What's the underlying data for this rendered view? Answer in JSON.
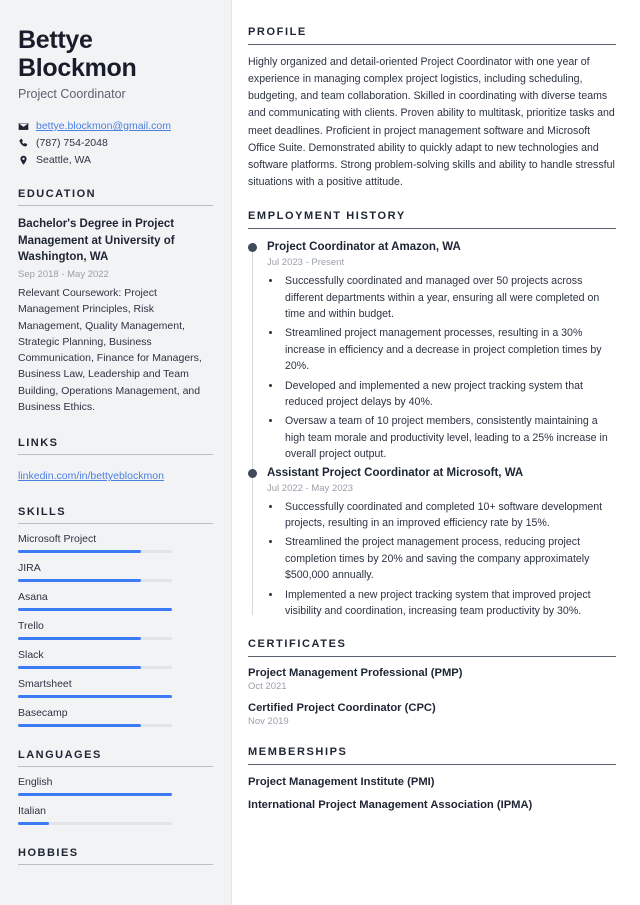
{
  "header": {
    "first_name": "Bettye",
    "last_name": "Blockmon",
    "job_title": "Project Coordinator",
    "contacts": [
      {
        "icon": "envelope-icon",
        "value": "bettye.blockmon@gmail.com",
        "is_link": true
      },
      {
        "icon": "phone-icon",
        "value": "(787) 754-2048",
        "is_link": false
      },
      {
        "icon": "location-pin-icon",
        "value": "Seattle, WA",
        "is_link": false
      }
    ]
  },
  "sidebar": {
    "education": {
      "heading": "EDUCATION",
      "degree": "Bachelor's Degree in Project Management at University of Washington, WA",
      "date": "Sep 2018 - May 2022",
      "description": "Relevant Coursework: Project Management Principles, Risk Management, Quality Management, Strategic Planning, Business Communication, Finance for Managers, Business Law, Leadership and Team Building, Operations Management, and Business Ethics."
    },
    "links": {
      "heading": "LINKS",
      "items": [
        {
          "label": "linkedin.com/in/bettyeblockmon"
        }
      ]
    },
    "skills": {
      "heading": "SKILLS",
      "items": [
        {
          "label": "Microsoft Project",
          "level": 80
        },
        {
          "label": "JIRA",
          "level": 80
        },
        {
          "label": "Asana",
          "level": 100
        },
        {
          "label": "Trello",
          "level": 80
        },
        {
          "label": "Slack",
          "level": 80
        },
        {
          "label": "Smartsheet",
          "level": 100
        },
        {
          "label": "Basecamp",
          "level": 80
        }
      ]
    },
    "languages": {
      "heading": "LANGUAGES",
      "items": [
        {
          "label": "English",
          "level": 100
        },
        {
          "label": "Italian",
          "level": 20
        }
      ]
    },
    "hobbies": {
      "heading": "HOBBIES"
    }
  },
  "main": {
    "profile": {
      "heading": "PROFILE",
      "text": "Highly organized and detail-oriented Project Coordinator with one year of experience in managing complex project logistics, including scheduling, budgeting, and team collaboration. Skilled in coordinating with diverse teams and communicating with clients. Proven ability to multitask, prioritize tasks and meet deadlines. Proficient in project management software and Microsoft Office Suite. Demonstrated ability to quickly adapt to new technologies and software platforms. Strong problem-solving skills and ability to handle stressful situations with a positive attitude."
    },
    "employment": {
      "heading": "EMPLOYMENT HISTORY",
      "jobs": [
        {
          "role": "Project Coordinator at Amazon, WA",
          "date": "Jul 2023 - Present",
          "bullets": [
            "Successfully coordinated and managed over 50 projects across different departments within a year, ensuring all were completed on time and within budget.",
            "Streamlined project management processes, resulting in a 30% increase in efficiency and a decrease in project completion times by 20%.",
            "Developed and implemented a new project tracking system that reduced project delays by 40%.",
            "Oversaw a team of 10 project members, consistently maintaining a high team morale and productivity level, leading to a 25% increase in overall project output."
          ]
        },
        {
          "role": "Assistant Project Coordinator at Microsoft, WA",
          "date": "Jul 2022 - May 2023",
          "bullets": [
            "Successfully coordinated and completed 10+ software development projects, resulting in an improved efficiency rate by 15%.",
            "Streamlined the project management process, reducing project completion times by 20% and saving the company approximately $500,000 annually.",
            "Implemented a new project tracking system that improved project visibility and coordination, increasing team productivity by 30%."
          ]
        }
      ]
    },
    "certificates": {
      "heading": "CERTIFICATES",
      "items": [
        {
          "name": "Project Management Professional (PMP)",
          "date": "Oct 2021"
        },
        {
          "name": "Certified Project Coordinator (CPC)",
          "date": "Nov 2019"
        }
      ]
    },
    "memberships": {
      "heading": "MEMBERSHIPS",
      "items": [
        {
          "name": "Project Management Institute (PMI)"
        },
        {
          "name": "International Project Management Association (IPMA)"
        }
      ]
    }
  },
  "colors": {
    "accent": "#3b7bf5",
    "link": "#4b7fe0",
    "heading": "#1d2433",
    "sidebar_bg": "#f2f3f5"
  }
}
